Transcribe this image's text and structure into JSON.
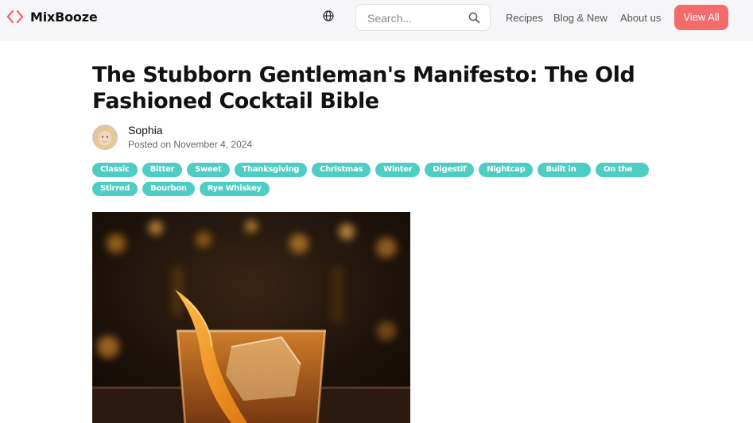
{
  "brand": {
    "name": "MixBooze",
    "accent": "#f46b6b"
  },
  "search": {
    "placeholder": "Search..."
  },
  "nav": {
    "recipes": "Recipes",
    "blog": "Blog & New",
    "about": "About us",
    "view_all": "View All"
  },
  "article": {
    "title": "The Stubborn Gentleman's Manifesto: The Old Fashioned Cocktail Bible",
    "author": "Sophia",
    "date": "Posted on November 4, 2024",
    "tags_row1": [
      "Classic",
      "Bitter",
      "Sweet",
      "Thanksgiving",
      "Christmas",
      "Winter",
      "Digestif",
      "Nightcap",
      "Built in Glass",
      "On the Rocks"
    ],
    "tags_row2": [
      "Stirred",
      "Bourbon",
      "Rye Whiskey"
    ]
  },
  "colors": {
    "tag_bg": "#4ecdc4",
    "header_bg": "#f6f6f8"
  },
  "icons": {
    "logo": "code-brackets-icon",
    "language": "globe-icon",
    "search": "search-icon"
  }
}
